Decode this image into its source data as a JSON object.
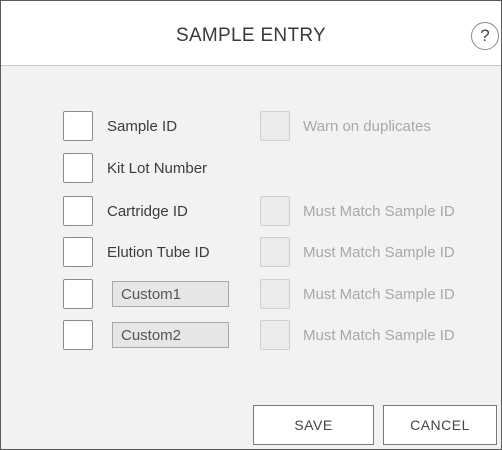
{
  "dialog": {
    "title": "SAMPLE ENTRY",
    "help_label": "?"
  },
  "fields": [
    {
      "label": "Sample ID",
      "option_label": "Warn on duplicates",
      "option_enabled": false
    },
    {
      "label": "Kit Lot Number"
    },
    {
      "label": "Cartridge ID",
      "option_label": "Must Match Sample ID",
      "option_enabled": false
    },
    {
      "label": "Elution Tube ID",
      "option_label": "Must Match Sample ID",
      "option_enabled": false
    },
    {
      "input_value": "Custom1",
      "option_label": "Must Match Sample ID",
      "option_enabled": false
    },
    {
      "input_value": "Custom2",
      "option_label": "Must Match Sample ID",
      "option_enabled": false
    }
  ],
  "actions": {
    "save_label": "SAVE",
    "cancel_label": "CANCEL"
  }
}
